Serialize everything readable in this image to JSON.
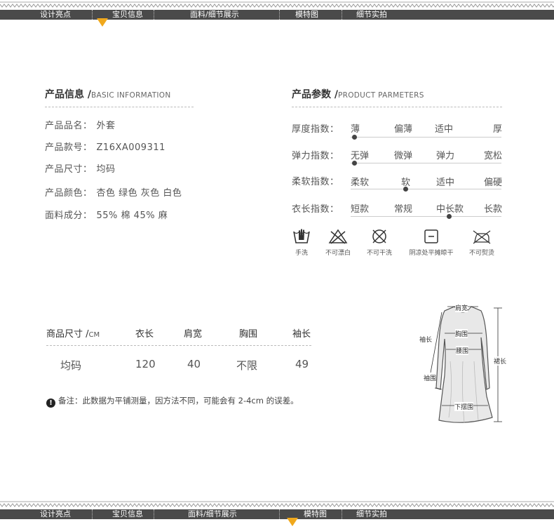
{
  "nav": {
    "tabs": [
      {
        "label": "设计亮点"
      },
      {
        "label": "宝贝信息"
      },
      {
        "label": "面料/细节展示"
      },
      {
        "label": "模特图"
      },
      {
        "label": "细节实拍"
      }
    ],
    "top_active": "宝贝信息",
    "bottom_active": "模特图"
  },
  "product_info": {
    "title": "产品信息 /",
    "title_en": "BASIC INFORMATION",
    "rows": [
      {
        "label": "产品品名：",
        "value": "外套"
      },
      {
        "label": "产品款号：",
        "value": "Z16XA009311"
      },
      {
        "label": "产品尺寸：",
        "value": "均码"
      },
      {
        "label": "产品颜色：",
        "value": "杏色 绿色 灰色 白色"
      },
      {
        "label": "面料成分：",
        "value": "55% 棉 45% 麻"
      }
    ]
  },
  "params": {
    "title": "产品参数 /",
    "title_en": "PRODUCT PARMETERS",
    "rows": [
      {
        "label": "厚度指数：",
        "options": [
          "薄",
          "偏薄",
          "适中",
          "厚"
        ],
        "selected_index": 0
      },
      {
        "label": "弹力指数：",
        "options": [
          "无弹",
          "微弹",
          "弹力",
          "宽松"
        ],
        "selected_index": 0
      },
      {
        "label": "柔软指数：",
        "options": [
          "柔软",
          "软",
          "适中",
          "偏硬"
        ],
        "selected_index": 1
      },
      {
        "label": "衣长指数：",
        "options": [
          "短款",
          "常规",
          "中长款",
          "长款"
        ],
        "selected_index": 2
      }
    ]
  },
  "care": [
    {
      "icon": "hand-wash-icon",
      "label": "手洗"
    },
    {
      "icon": "no-bleach-icon",
      "label": "不可漂白"
    },
    {
      "icon": "no-dry-clean-icon",
      "label": "不可干洗"
    },
    {
      "icon": "shade-dry-icon",
      "label": "阴凉处平摊晾干"
    },
    {
      "icon": "no-iron-icon",
      "label": "不可熨烫"
    }
  ],
  "size_table": {
    "headers": [
      "商品尺寸 /",
      "衣长",
      "肩宽",
      "胸围",
      "袖长"
    ],
    "unit": "CM",
    "rows": [
      [
        "均码",
        "120",
        "40",
        "不限",
        "49"
      ]
    ]
  },
  "note": {
    "icon": "exclamation-icon",
    "text": "备注：此数据为平铺测量，因方法不同，可能会有 2-4cm 的误差。"
  },
  "diagram": {
    "labels": {
      "shoulder": "肩宽",
      "sleeve": "袖长",
      "bust": "胸围",
      "waist": "腰围",
      "cuff": "袖围",
      "length": "裙长",
      "hem": "下摆围"
    }
  },
  "colors": {
    "nav_band": "#4a4a4a",
    "nav_marker": "#f0a81c",
    "text": "#555555"
  }
}
